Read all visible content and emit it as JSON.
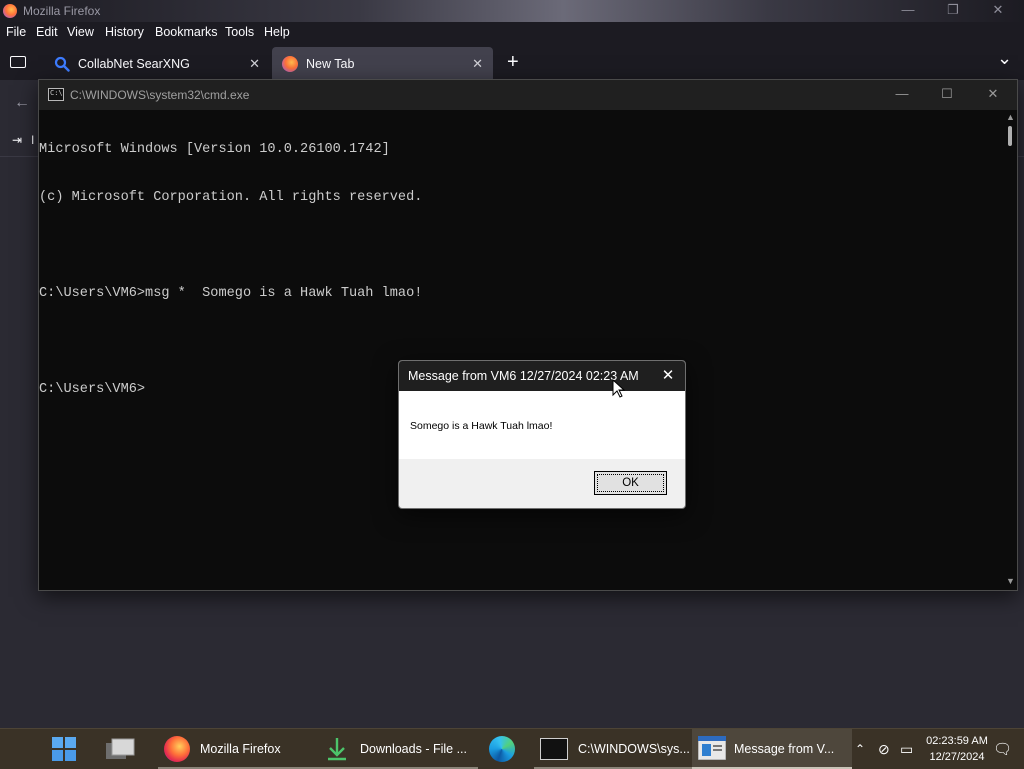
{
  "firefox": {
    "window_title": "Mozilla Firefox",
    "menu": [
      "File",
      "Edit",
      "View",
      "History",
      "Bookmarks",
      "Tools",
      "Help"
    ],
    "tabs": [
      {
        "label": "CollabNet SearXNG",
        "active": false
      },
      {
        "label": "New Tab",
        "active": true
      }
    ],
    "new_tab_symbol": "+",
    "list_all_tabs_symbol": "⌄",
    "import_partial": "I"
  },
  "cmd": {
    "title": "C:\\WINDOWS\\system32\\cmd.exe",
    "lines": [
      "Microsoft Windows [Version 10.0.26100.1742]",
      "(c) Microsoft Corporation. All rights reserved.",
      "",
      "C:\\Users\\VM6>msg *  Somego is a Hawk Tuah lmao!",
      "",
      "C:\\Users\\VM6>"
    ],
    "background": "#0c0c0c",
    "text_color": "#cccccc"
  },
  "message_box": {
    "title": "Message from VM6 12/27/2024 02:23 AM",
    "text": "Somego is a Hawk Tuah lmao!",
    "ok_label": "OK"
  },
  "taskbar": {
    "items": [
      {
        "label": "Mozilla Firefox",
        "icon": "firefox-icon"
      },
      {
        "label": "Downloads - File ...",
        "icon": "downloads-icon"
      },
      {
        "label": "",
        "icon": "edge-icon"
      },
      {
        "label": "C:\\WINDOWS\\sys...",
        "icon": "cmd-icon"
      },
      {
        "label": "Message from V...",
        "icon": "message-icon",
        "active": true
      }
    ],
    "clock_time": "02:23:59 AM",
    "clock_date": "12/27/2024",
    "accent": "#3a3226"
  }
}
